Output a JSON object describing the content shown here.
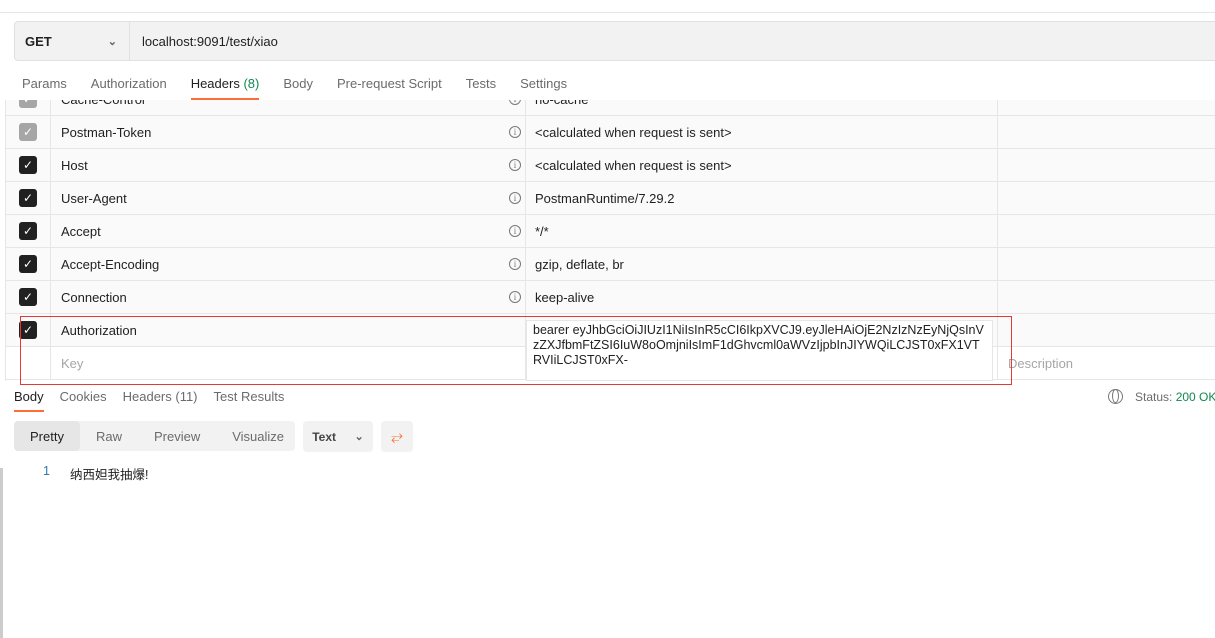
{
  "request": {
    "method": "GET",
    "url": "localhost:9091/test/xiao"
  },
  "tabs": [
    {
      "label": "Params"
    },
    {
      "label": "Authorization"
    },
    {
      "label": "Headers",
      "count": "(8)"
    },
    {
      "label": "Body"
    },
    {
      "label": "Pre-request Script"
    },
    {
      "label": "Tests"
    },
    {
      "label": "Settings"
    }
  ],
  "headers": [
    {
      "key": "Cache-Control",
      "value": "no-cache",
      "enabled": "disabled"
    },
    {
      "key": "Postman-Token",
      "value": "<calculated when request is sent>",
      "enabled": "disabled"
    },
    {
      "key": "Host",
      "value": "<calculated when request is sent>",
      "enabled": "checked"
    },
    {
      "key": "User-Agent",
      "value": "PostmanRuntime/7.29.2",
      "enabled": "checked"
    },
    {
      "key": "Accept",
      "value": "*/*",
      "enabled": "checked"
    },
    {
      "key": "Accept-Encoding",
      "value": "gzip, deflate, br",
      "enabled": "checked"
    },
    {
      "key": "Connection",
      "value": "keep-alive",
      "enabled": "checked"
    },
    {
      "key": "Authorization",
      "value": "bearer eyJhbGciOiJIUzI1NiIsInR5cCI6IkpXVCJ9.eyJleHAiOjE2NzIzNzEyNjQsInVzZXJfbmFtZSI6IuW8oOmjniIsImF1dGhvcml0aWVzIjpbInJIYWQiLCJST0xFX1VTRVIiLCJST0xFX-",
      "enabled": "checked"
    }
  ],
  "new_row": {
    "key_placeholder": "Key",
    "description_placeholder": "Description"
  },
  "response": {
    "tabs": [
      "Body",
      "Cookies",
      "Headers (11)",
      "Test Results"
    ],
    "status_label": "Status:",
    "status_value": "200 OK",
    "views": [
      "Pretty",
      "Raw",
      "Preview",
      "Visualize"
    ],
    "format": "Text",
    "lines": [
      {
        "n": "1",
        "text": "纳西妲我抽爆!"
      }
    ]
  },
  "colors": {
    "accent": "#ff6c37",
    "success": "#0f8a4f",
    "highlight": "#e53935"
  }
}
